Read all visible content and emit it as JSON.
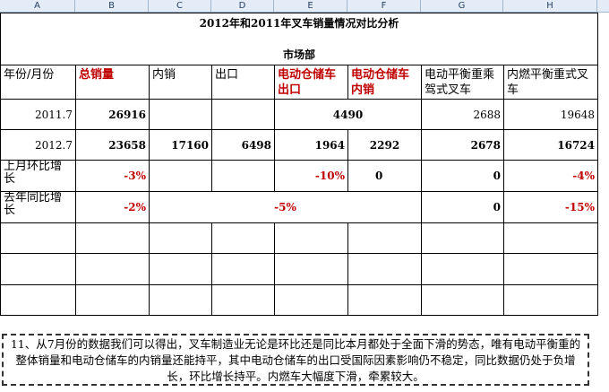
{
  "columns": [
    "A",
    "B",
    "C",
    "D",
    "E",
    "F",
    "G",
    "H"
  ],
  "title": "2012年和2011年叉车销量情况对比分析",
  "subtitle": "市场部",
  "headers": {
    "period": "年份/月份",
    "total": "总销量",
    "domestic": "内销",
    "export": "出口",
    "ew_export": "电动仓储车出口",
    "ew_domestic": "电动仓储车内销",
    "ec_ride": "电动平衡重乘驾式叉车",
    "ic": "内燃平衡重式叉车"
  },
  "rows": {
    "r2011": {
      "period": "2011.7",
      "total": "26916",
      "domestic": "",
      "export": "",
      "ew_merged": "4490",
      "ec_ride": "2688",
      "ic": "19648"
    },
    "r2012": {
      "period": "2012.7",
      "total": "23658",
      "domestic": "17160",
      "export": "6498",
      "ew_export": "1964",
      "ew_domestic": "2292",
      "ec_ride": "2678",
      "ic": "16724"
    },
    "mom": {
      "label": "上月环比增长",
      "total": "-3%",
      "ew_export": "-10%",
      "ew_domestic": "0",
      "ec_ride": "0",
      "ic": "-4%"
    },
    "yoy": {
      "label": "去年同比增长",
      "total": "-2%",
      "ew_merged": "-5%",
      "ec_ride": "0",
      "ic": "-15%"
    }
  },
  "note": "11、从7月份的数据我们可以得出，叉车制造业无论是环比还是同比本月都处于全面下滑的势态，唯有电动平衡重的整体销量和电动仓储车的内销量还能持平，其中电动仓储车的出口受国际因素影响仍不稳定，同比数据仍处于负增长，环比增长持平。内燃车大幅度下滑，牵累较大。"
}
